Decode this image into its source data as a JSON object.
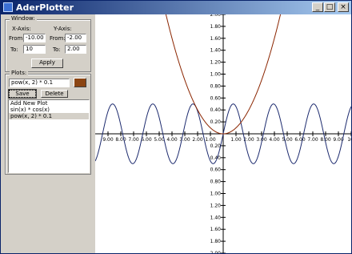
{
  "window": {
    "title": "AderPlotter",
    "buttons": [
      "_",
      "□",
      "×"
    ]
  },
  "window_group": {
    "legend": "Window:",
    "x_axis_label": "X-Axis:",
    "y_axis_label": "Y-Axis:",
    "x_from_label": "From:",
    "x_to_label": "To:",
    "y_from_label": "From:",
    "y_to_label": "To:",
    "x_from": "-10.00",
    "x_to": "10",
    "y_from": "-2.00",
    "y_to": "2.00",
    "apply_label": "Apply"
  },
  "plots_group": {
    "legend": "Plots:",
    "expression": "pow(x, 2) * 0.1",
    "color": "#8b4513",
    "save_label": "Save",
    "delete_label": "Delete",
    "list_items": [
      {
        "text": "Add New Plot",
        "selected": false
      },
      {
        "text": "sin(x) * cos(x)",
        "selected": false
      },
      {
        "text": "pow(x, 2) * 0.1",
        "selected": true
      }
    ]
  },
  "chart_data": {
    "type": "line",
    "xlim": [
      -10,
      10
    ],
    "ylim": [
      -2,
      2
    ],
    "x_tick_labels": [
      "9.00",
      "8.00",
      "7.00",
      "6.00",
      "5.00",
      "4.00",
      "3.00",
      "2.00",
      "1.00",
      "",
      "1.00",
      "2.00",
      "3.00",
      "4.00",
      "5.00",
      "6.00",
      "7.00",
      "8.00",
      "9.00",
      "10."
    ],
    "y_tick_labels": [
      "2.00",
      "1.80",
      "1.60",
      "1.40",
      "1.20",
      "1.00",
      "0.80",
      "0.60",
      "0.40",
      "0.20",
      "",
      "0.20",
      "0.40",
      "0.60",
      "0.80",
      "1.00",
      "1.20",
      "1.40",
      "1.60",
      "1.80",
      "2.00"
    ],
    "series": [
      {
        "expr": "sin(x) * cos(x)",
        "color": "#1c2a6e"
      },
      {
        "expr": "pow(x, 2) * 0.1",
        "color": "#8b2500"
      }
    ]
  }
}
